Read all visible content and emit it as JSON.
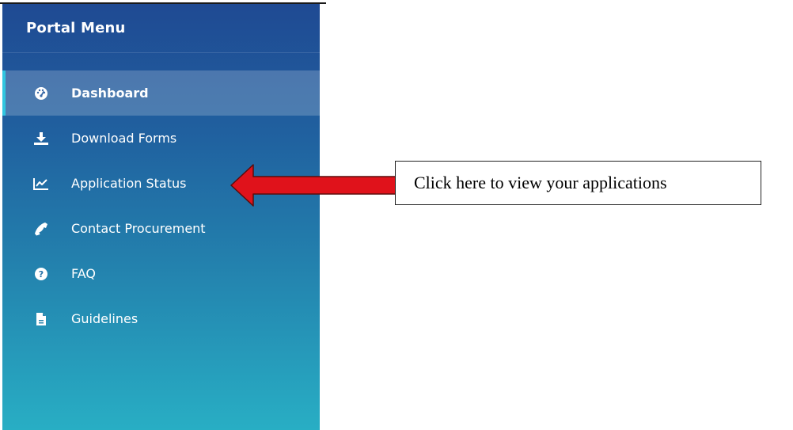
{
  "sidebar": {
    "title": "Portal Menu",
    "items": [
      {
        "label": "Dashboard",
        "icon": "dashboard-gauge-icon",
        "active": true
      },
      {
        "label": "Download Forms",
        "icon": "download-icon",
        "active": false
      },
      {
        "label": "Application Status",
        "icon": "line-chart-icon",
        "active": false
      },
      {
        "label": "Contact Procurement",
        "icon": "phone-icon",
        "active": false
      },
      {
        "label": "FAQ",
        "icon": "question-circle-icon",
        "active": false
      },
      {
        "label": "Guidelines",
        "icon": "document-icon",
        "active": false
      }
    ]
  },
  "callout": {
    "text": "Click here to view your applications",
    "arrow_color": "#e0121b"
  },
  "colors": {
    "sidebar_top": "#1f4a93",
    "sidebar_bottom": "#28aec4",
    "active_accent": "#2fc6e0"
  }
}
